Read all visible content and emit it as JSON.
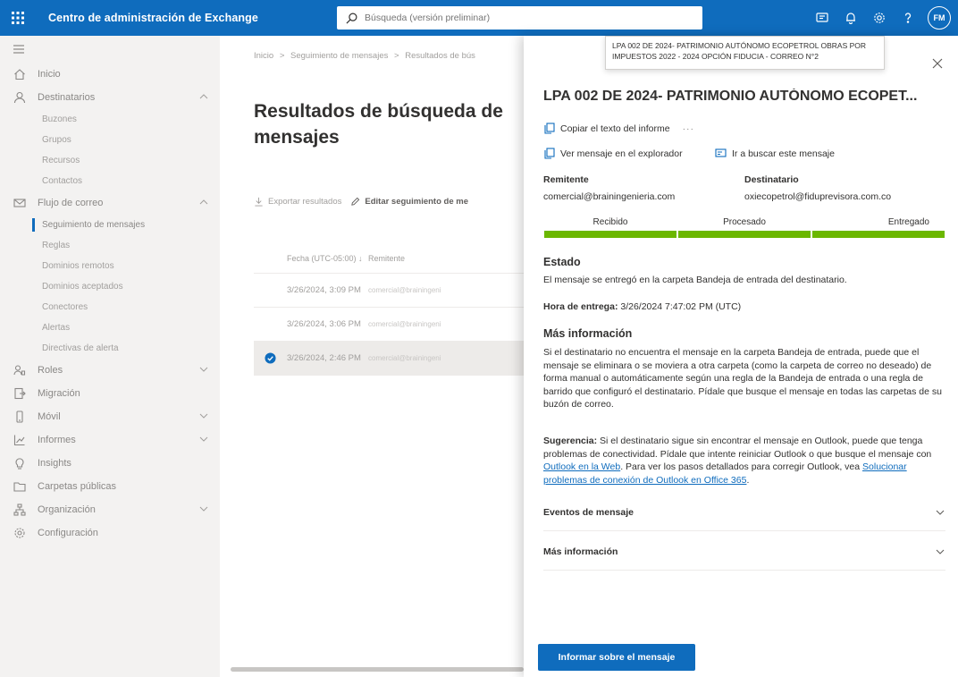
{
  "topbar": {
    "title": "Centro de administración de Exchange",
    "search_placeholder": "Búsqueda (versión preliminar)",
    "avatar_initials": "FM"
  },
  "sidebar": {
    "items": [
      {
        "label": "Inicio"
      },
      {
        "label": "Destinatarios"
      },
      {
        "label": "Buzones"
      },
      {
        "label": "Grupos"
      },
      {
        "label": "Recursos"
      },
      {
        "label": "Contactos"
      },
      {
        "label": "Flujo de correo"
      },
      {
        "label": "Seguimiento de mensajes"
      },
      {
        "label": "Reglas"
      },
      {
        "label": "Dominios remotos"
      },
      {
        "label": "Dominios aceptados"
      },
      {
        "label": "Conectores"
      },
      {
        "label": "Alertas"
      },
      {
        "label": "Directivas de alerta"
      },
      {
        "label": "Roles"
      },
      {
        "label": "Migración"
      },
      {
        "label": "Móvil"
      },
      {
        "label": "Informes"
      },
      {
        "label": "Insights"
      },
      {
        "label": "Carpetas públicas"
      },
      {
        "label": "Organización"
      },
      {
        "label": "Configuración"
      }
    ]
  },
  "main": {
    "breadcrumb": [
      "Inicio",
      ">",
      "Seguimiento de mensajes",
      ">",
      "Resultados de bús"
    ],
    "title_line1": "Resultados de búsqueda de",
    "title_line2": "mensajes",
    "export_label": "Exportar resultados",
    "edit_label": "Editar seguimiento de me",
    "col_date": "Fecha (UTC-05:00) ↓",
    "col_sender": "Remitente",
    "rows": [
      {
        "date": "3/26/2024, 3:09 PM",
        "sender": "comercial@brainingeni"
      },
      {
        "date": "3/26/2024, 3:06 PM",
        "sender": "comercial@brainingeni"
      },
      {
        "date": "3/26/2024, 2:46 PM",
        "sender": "comercial@brainingeni"
      }
    ]
  },
  "tooltip": {
    "text": "LPA 002 DE 2024- PATRIMONIO AUTÓNOMO ECOPETROL OBRAS POR IMPUESTOS 2022 - 2024 OPCIÓN FIDUCIA - CORREO N°2"
  },
  "panel": {
    "title": "LPA 002 DE 2024- PATRIMONIO AUTÓNOMO ECOPET...",
    "copy_label": "Copiar el texto del informe",
    "more": "···",
    "view_label": "Ver mensaje en el explorador",
    "trace_label": "Ir a buscar este mensaje",
    "sender_label": "Remitente",
    "sender_value": "comercial@brainingenieria.com",
    "recipient_label": "Destinatario",
    "recipient_value": "oxiecopetrol@fiduprevisora.com.co",
    "steps": [
      "Recibido",
      "Procesado",
      "Entregado"
    ],
    "status_heading": "Estado",
    "status_text": "El mensaje se entregó en la carpeta Bandeja de entrada del destinatario.",
    "delivery_label": "Hora de entrega:",
    "delivery_value": "3/26/2024 7:47:02 PM (UTC)",
    "more_info_heading": "Más información",
    "more_info_text": "Si el destinatario no encuentra el mensaje en la carpeta Bandeja de entrada, puede que el mensaje se eliminara o se moviera a otra carpeta (como la carpeta de correo no deseado) de forma manual o automáticamente según una regla de la Bandeja de entrada o una regla de barrido que configuró el destinatario. Pídale que busque el mensaje en todas las carpetas de su buzón de correo.",
    "tip_label": "Sugerencia:",
    "tip_text_1": "Si el destinatario sigue sin encontrar el mensaje en Outlook, puede que tenga problemas de conectividad. Pídale que intente reiniciar Outlook o que busque el mensaje con",
    "tip_link_1": "Outlook en la Web",
    "tip_text_2": ". Para ver los pasos detallados para corregir Outlook, vea",
    "tip_link_2": "Solucionar problemas de conexión de Outlook en Office 365",
    "tip_text_3": ".",
    "events_label": "Eventos de mensaje",
    "more_info_acc_label": "Más información",
    "report_button": "Informar sobre el mensaje"
  },
  "colors": {
    "brand": "#0f6cbd",
    "progress": "#6bb700"
  }
}
